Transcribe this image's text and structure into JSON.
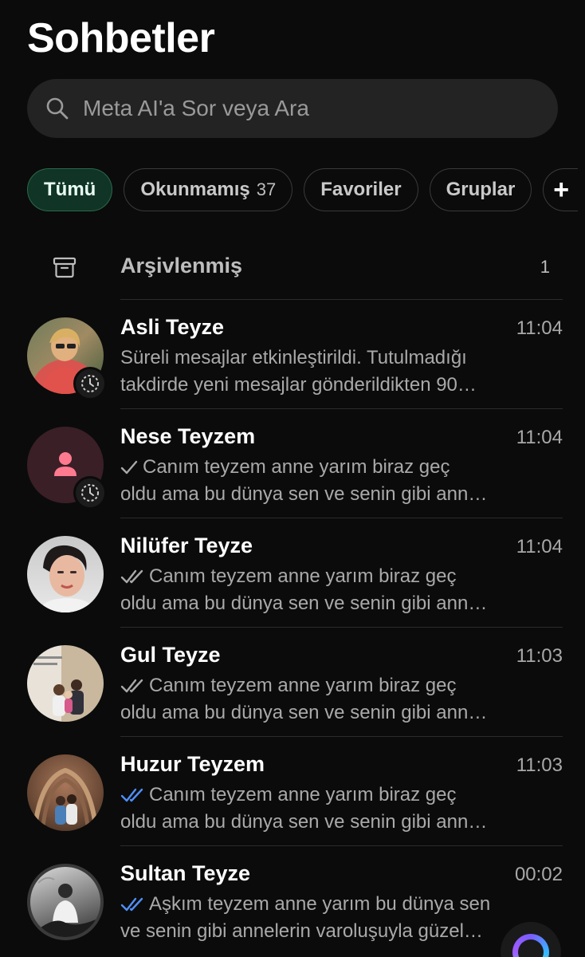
{
  "header": {
    "title": "Sohbetler"
  },
  "search": {
    "placeholder": "Meta AI'a Sor veya Ara"
  },
  "filters": [
    {
      "label": "Tümü",
      "active": true
    },
    {
      "label": "Okunmamış",
      "count": "37"
    },
    {
      "label": "Favoriler"
    },
    {
      "label": "Gruplar"
    },
    {
      "label": "+"
    }
  ],
  "archive": {
    "label": "Arşivlenmiş",
    "count": "1"
  },
  "chats": [
    {
      "name": "Asli Teyze",
      "time": "11:04",
      "line1": "Süreli mesajlar etkinleştirildi. Tutulmadığı",
      "line2": "takdirde yeni mesajlar gönderildikten 90…",
      "tick": "none"
    },
    {
      "name": "Nese Teyzem",
      "time": "11:04",
      "line1": "Canım  teyzem anne yarım biraz geç",
      "line2": "oldu ama bu dünya sen ve senin gibi ann…",
      "tick": "single"
    },
    {
      "name": "Nilüfer Teyze",
      "time": "11:04",
      "line1": "Canım  teyzem anne yarım biraz geç",
      "line2": "oldu ama bu dünya sen ve senin gibi ann…",
      "tick": "double-grey"
    },
    {
      "name": "Gul Teyze",
      "time": "11:03",
      "line1": "Canım  teyzem anne yarım biraz geç",
      "line2": "oldu ama bu dünya sen ve senin gibi ann…",
      "tick": "double-grey"
    },
    {
      "name": "Huzur Teyzem",
      "time": "11:03",
      "line1": "Canım  teyzem anne yarım biraz geç",
      "line2": "oldu ama bu dünya sen ve senin gibi ann…",
      "tick": "double-blue"
    },
    {
      "name": "Sultan Teyze",
      "time": "00:02",
      "line1": "Aşkım teyzem anne yarım bu dünya sen",
      "line2": "ve senin gibi annelerin varoluşuyla güzel…",
      "tick": "double-blue"
    }
  ],
  "colors": {
    "accent": "#103426",
    "read_tick": "#4f8ff7",
    "muted": "#a9a9a9"
  },
  "icons": {
    "search": "search-icon",
    "archive": "archive-icon",
    "timer": "disappearing-timer-icon",
    "fab": "meta-ai-icon"
  }
}
